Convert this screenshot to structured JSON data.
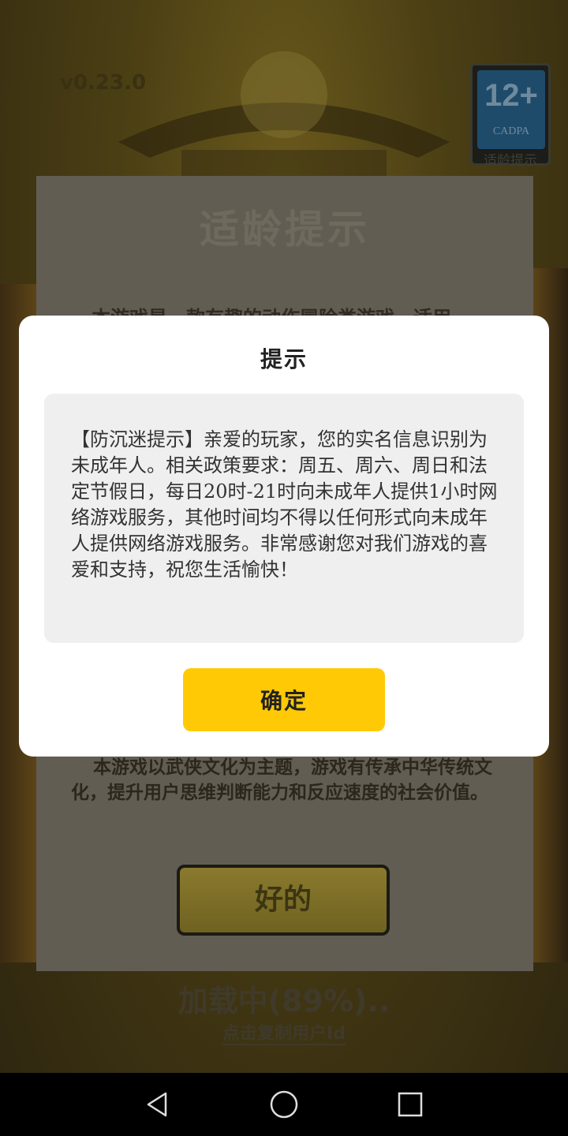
{
  "game": {
    "version": "v0.23.0",
    "age_rating": {
      "number": "12+",
      "org": "CADPA",
      "caption": "适龄提示"
    },
    "panel": {
      "title": "适龄提示",
      "intro": "本游戏是一款有趣的动作冒险类游戏，适用",
      "body": "本游戏以武侠文化为主题，游戏有传承中华传统文化，提升用户思维判断能力和反应速度的社会价值。",
      "ok_label": "好的"
    },
    "loading_text": "加载中(89%)..",
    "copy_id_label": "点击复制用户Id"
  },
  "dialog": {
    "title": "提示",
    "message": "【防沉迷提示】亲爱的玩家，您的实名信息识别为未成年人。相关政策要求：周五、周六、周日和法定节假日，每日20时-21时向未成年人提供1小时网络游戏服务，其他时间均不得以任何形式向未成年人提供网络游戏服务。非常感谢您对我们游戏的喜爱和支持，祝您生活愉快！",
    "confirm_label": "确定"
  },
  "navbar": {
    "back_icon": "back-triangle",
    "home_icon": "home-circle",
    "recents_icon": "recents-square"
  },
  "colors": {
    "accent": "#ffc905",
    "overlay_panel": "#615d52",
    "navbar": "#000000"
  }
}
